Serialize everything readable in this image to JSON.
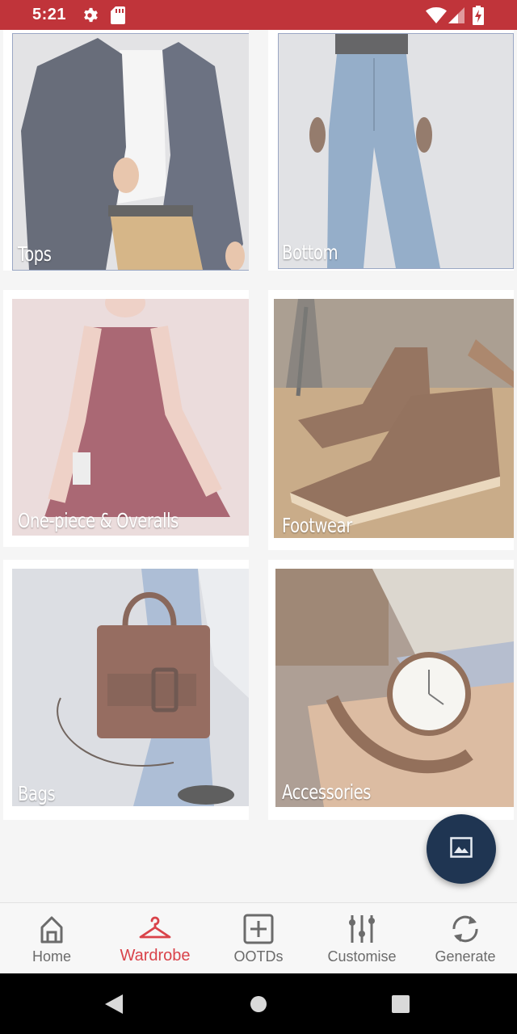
{
  "status_bar": {
    "time": "5:21",
    "background": "#c0343a"
  },
  "categories": [
    {
      "label": "Tops"
    },
    {
      "label": "Bottom"
    },
    {
      "label": "One-piece & Overalls"
    },
    {
      "label": "Footwear"
    },
    {
      "label": "Bags"
    },
    {
      "label": "Accessories"
    }
  ],
  "fab": {
    "icon": "image-icon",
    "color": "#1f3552"
  },
  "bottom_nav": {
    "active_color": "#d9434a",
    "items": [
      {
        "label": "Home",
        "icon": "home-icon"
      },
      {
        "label": "Wardrobe",
        "icon": "hanger-icon"
      },
      {
        "label": "OOTDs",
        "icon": "plus-square-icon"
      },
      {
        "label": "Customise",
        "icon": "sliders-icon"
      },
      {
        "label": "Generate",
        "icon": "refresh-icon"
      }
    ]
  }
}
